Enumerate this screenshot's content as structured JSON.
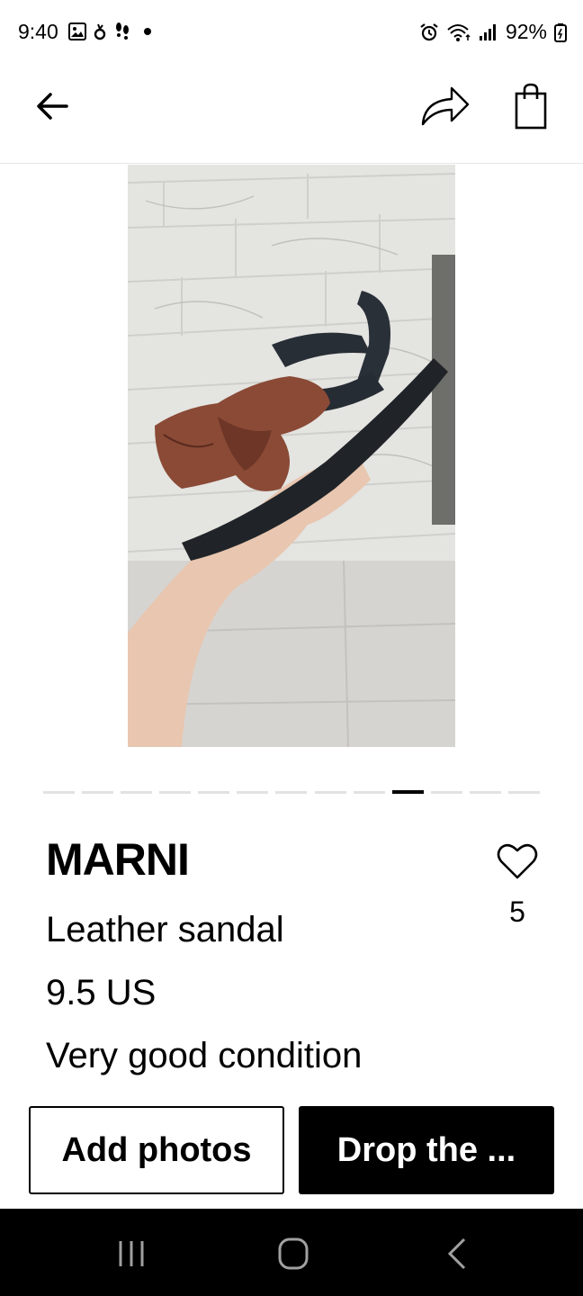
{
  "status_bar": {
    "time": "9:40",
    "left_icons": [
      "gallery-icon",
      "notification-icon",
      "footprints-icon",
      "dot-icon"
    ],
    "right_icons": [
      "alarm-icon",
      "wifi-icon",
      "signal-icon"
    ],
    "battery": "92%"
  },
  "header": {
    "back_icon": "arrow-left-icon",
    "share_icon": "share-arrow-icon",
    "bag_icon": "shopping-bag-icon"
  },
  "product": {
    "image_alt": "Leather sandal photo",
    "carousel": {
      "count": 13,
      "active_index": 9
    },
    "brand": "MARNI",
    "name": "Leather sandal",
    "size": "9.5 US",
    "condition": "Very good condition",
    "likes": "5"
  },
  "actions": {
    "add_photos": "Add photos",
    "drop": "Drop the ..."
  },
  "nav": {
    "recents_icon": "recents-icon",
    "home_icon": "home-icon",
    "back_icon": "nav-back-icon"
  }
}
